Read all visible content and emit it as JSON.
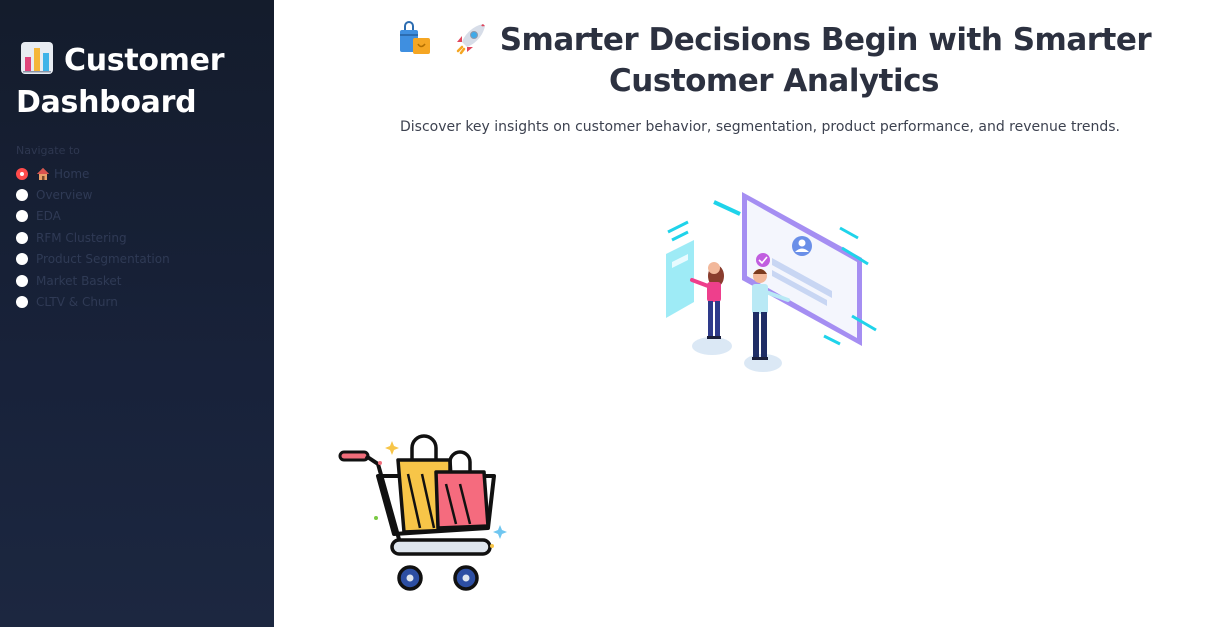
{
  "sidebar": {
    "title": "Customer Dashboard",
    "title_icon": "bar-chart-icon",
    "nav_label": "Navigate to",
    "items": [
      {
        "label": "Home",
        "icon": "house-icon",
        "selected": true
      },
      {
        "label": "Overview",
        "selected": false
      },
      {
        "label": "EDA",
        "selected": false
      },
      {
        "label": "RFM Clustering",
        "selected": false
      },
      {
        "label": "Product Segmentation",
        "selected": false
      },
      {
        "label": "Market Basket",
        "selected": false
      },
      {
        "label": "CLTV & Churn",
        "selected": false
      }
    ]
  },
  "main": {
    "headline": "Smarter Decisions Begin with Smarter Customer Analytics",
    "headline_icons": [
      "shopping-bags-icon",
      "rocket-icon"
    ],
    "subtitle": "Discover key insights on customer behavior, segmentation, product performance, and revenue trends.",
    "images": [
      "analytics-illustration",
      "shopping-cart-illustration"
    ]
  },
  "colors": {
    "sidebar_bg": "#141c2c",
    "accent": "#ff4b4b",
    "headline": "#2c3140"
  }
}
